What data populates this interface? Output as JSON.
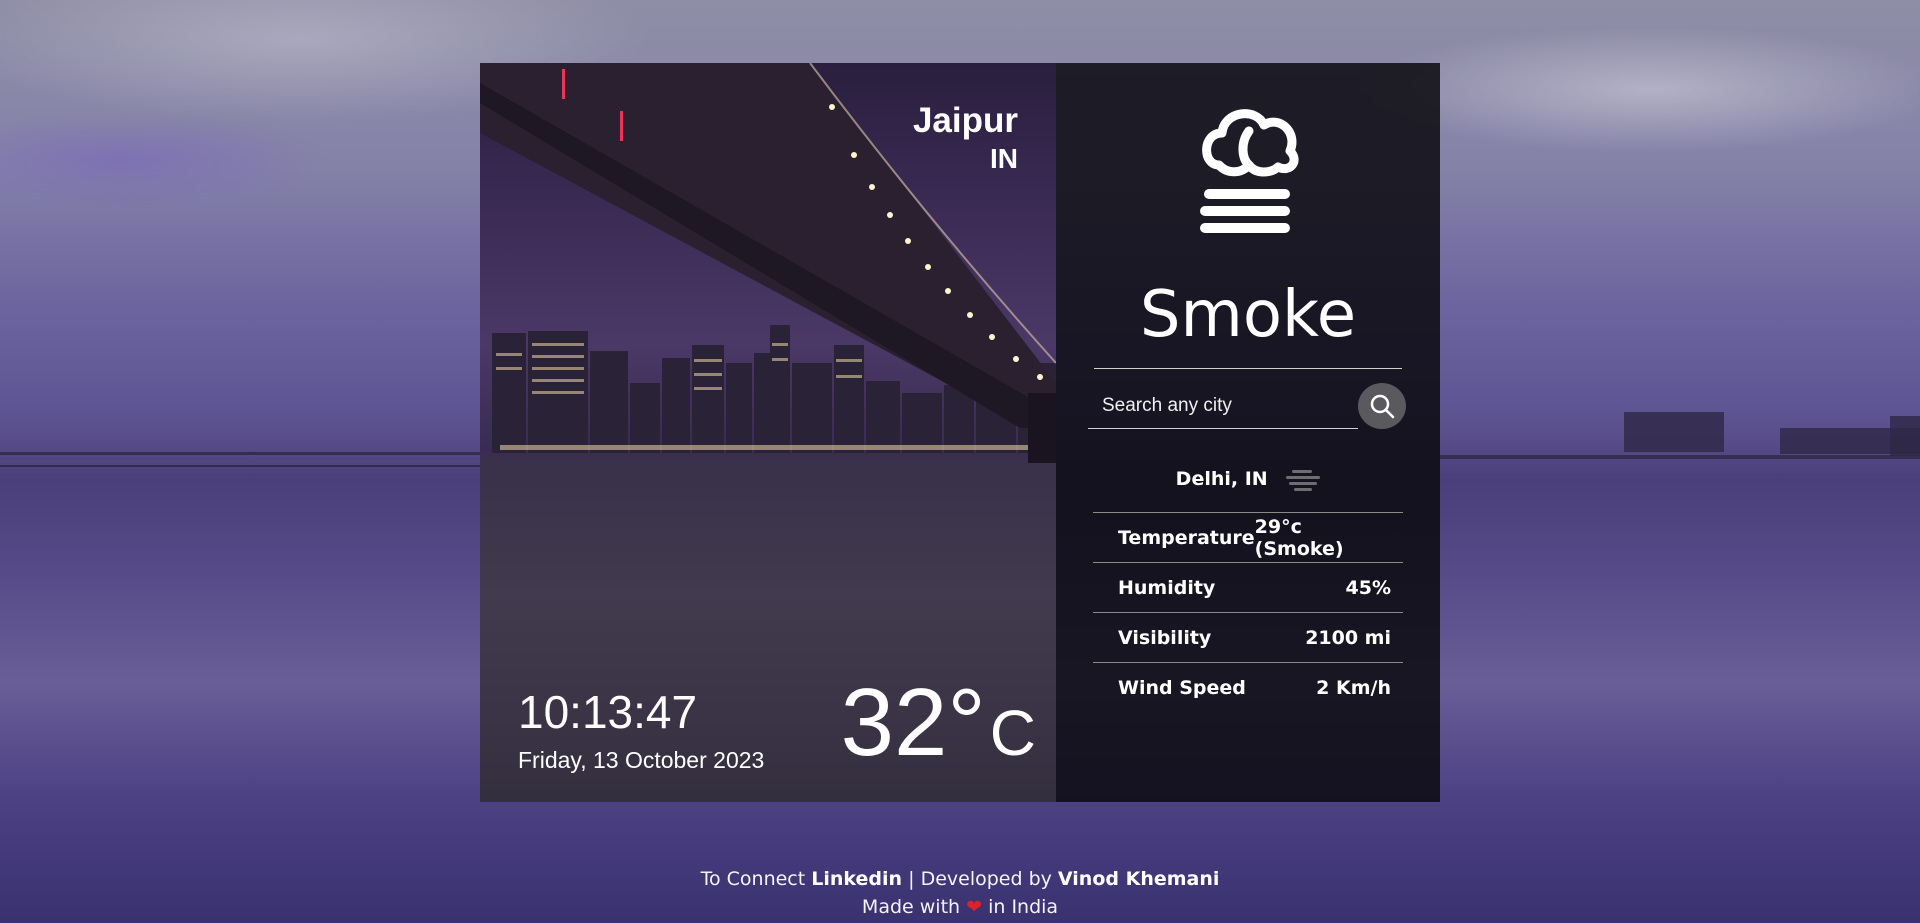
{
  "location": {
    "city": "Jaipur",
    "country": "IN"
  },
  "time": {
    "clock": "10:13:47",
    "date": "Friday, 13 October 2023"
  },
  "current_temp": {
    "value": "32°",
    "unit": "C"
  },
  "condition": {
    "label": "Smoke",
    "icon": "smoke-icon"
  },
  "search": {
    "placeholder": "Search any city"
  },
  "result": {
    "location": "Delhi, IN",
    "icon": "haze-icon",
    "stats": [
      {
        "label": "Temperature",
        "value": "29°c (Smoke)"
      },
      {
        "label": "Humidity",
        "value": "45%"
      },
      {
        "label": "Visibility",
        "value": "2100 mi"
      },
      {
        "label": "Wind Speed",
        "value": "2 Km/h"
      }
    ]
  },
  "footer": {
    "line1_prefix": "To Connect",
    "linkedin": "Linkedin",
    "separator": "|",
    "developed_by": "Developed by",
    "developer": "Vinod Khemani",
    "line2_prefix": "Made with",
    "line2_suffix": "in India"
  },
  "colors": {
    "panel_dark": "#0c0a10",
    "heart": "#e0202a",
    "search_button": "#5a5a5e"
  }
}
